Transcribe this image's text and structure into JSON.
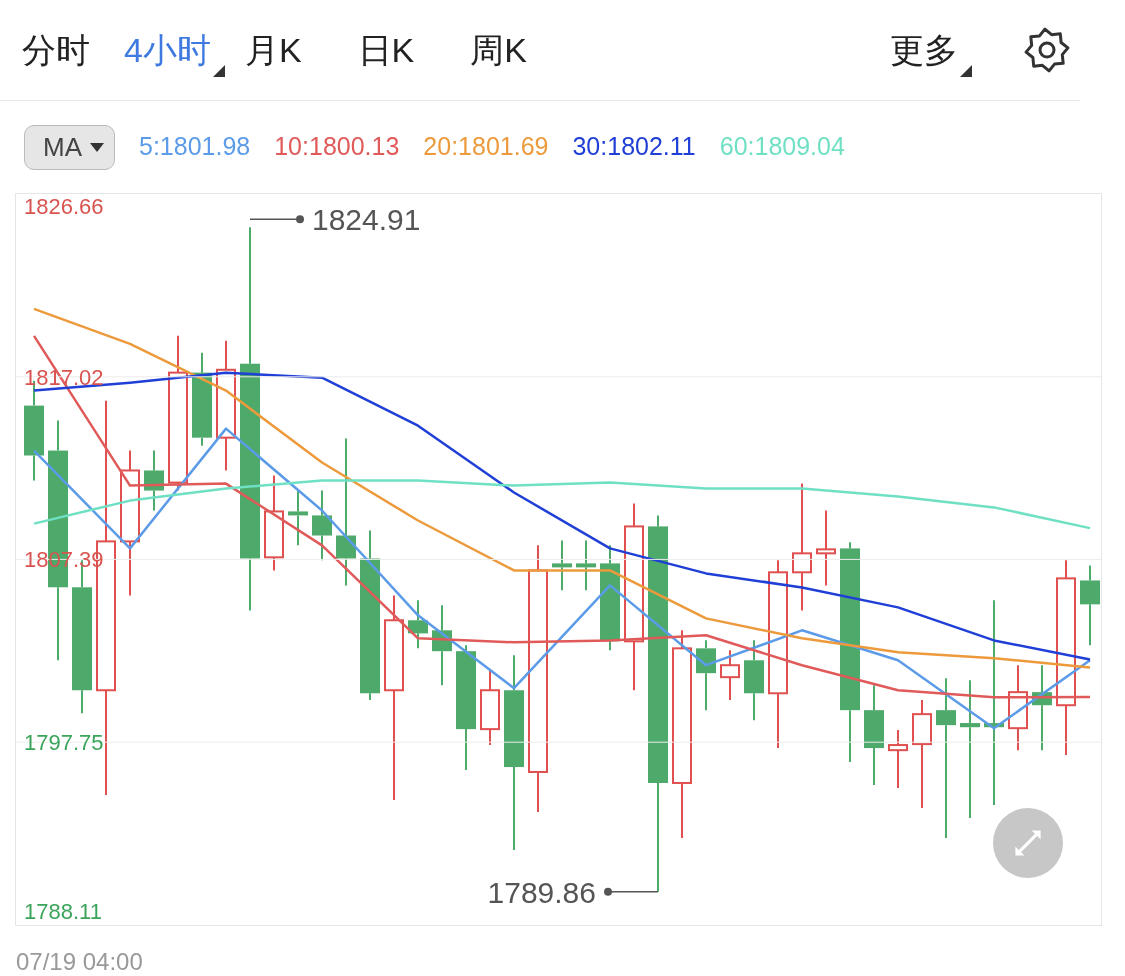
{
  "tabs": [
    {
      "label": "分时",
      "selected": false,
      "dropdown": false
    },
    {
      "label": "4小时",
      "selected": true,
      "dropdown": true
    },
    {
      "label": "月K",
      "selected": false,
      "dropdown": false
    },
    {
      "label": "日K",
      "selected": false,
      "dropdown": false
    },
    {
      "label": "周K",
      "selected": false,
      "dropdown": false
    }
  ],
  "more": {
    "label": "更多",
    "dropdown": true
  },
  "indicator": {
    "label": "MA"
  },
  "chart": {
    "chart_data": {
      "type": "line",
      "grid": true,
      "ylim": [
        1788.11,
        1826.66
      ],
      "yticks": [
        {
          "value": 1826.66,
          "label": "1826.66"
        },
        {
          "value": 1817.02,
          "label": "1817.02"
        },
        {
          "value": 1807.39,
          "label": "1807.39"
        },
        {
          "value": 1797.75,
          "label": "1797.75"
        },
        {
          "value": 1788.11,
          "label": "1788.11"
        }
      ],
      "series": [
        {
          "name": "5:1801.98",
          "color": "#5b9be8",
          "values": [
            1813.13,
            1807.97,
            1814.29,
            1809.97,
            1804.44,
            1800.6,
            1806.02,
            1801.81,
            1803.65,
            1802.07,
            1798.49,
            1802.07
          ]
        },
        {
          "name": "10:1800.13",
          "color": "#e05a5a",
          "values": [
            1819.18,
            1811.28,
            1811.39,
            1808.13,
            1803.23,
            1803.02,
            1803.12,
            1803.39,
            1801.81,
            1800.49,
            1800.12,
            1800.13
          ]
        },
        {
          "name": "20:1801.69",
          "color": "#ec9a3c",
          "values": [
            1820.6,
            1818.76,
            1816.29,
            1812.5,
            1809.44,
            1806.81,
            1806.81,
            1804.28,
            1803.23,
            1802.49,
            1802.18,
            1801.69
          ]
        },
        {
          "name": "30:1802.11",
          "color": "#1f3fd6",
          "values": [
            1816.29,
            1816.71,
            1817.23,
            1816.97,
            1814.44,
            1810.92,
            1807.97,
            1806.65,
            1805.91,
            1804.86,
            1803.12,
            1802.11
          ]
        },
        {
          "name": "60:1809.04",
          "color": "#6fe0c4",
          "values": [
            1809.28,
            1810.49,
            1811.13,
            1811.55,
            1811.55,
            1811.28,
            1811.44,
            1811.13,
            1811.13,
            1810.71,
            1810.13,
            1809.04
          ]
        }
      ],
      "annotations": [
        {
          "text": "1824.91"
        },
        {
          "text": "1789.86"
        }
      ]
    },
    "date_label": "07/19 04:00"
  }
}
